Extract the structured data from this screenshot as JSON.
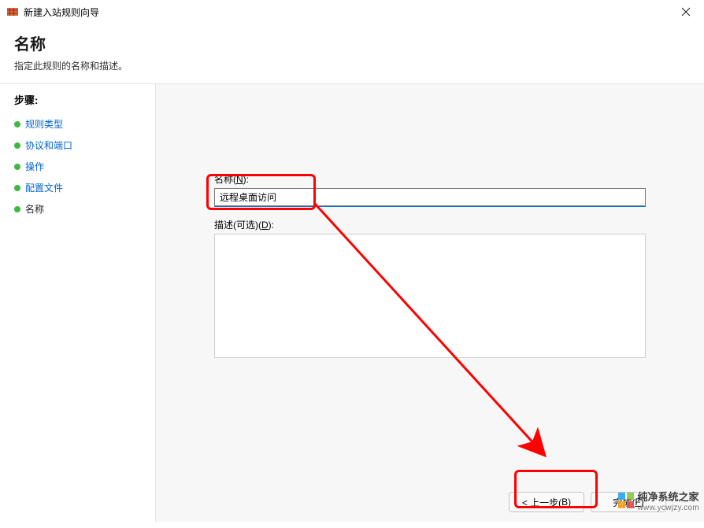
{
  "titlebar": {
    "text": "新建入站规则向导"
  },
  "header": {
    "title": "名称",
    "subtitle": "指定此规则的名称和描述。"
  },
  "sidebar": {
    "steps_label": "步骤:",
    "items": [
      {
        "label": "规则类型",
        "link": true
      },
      {
        "label": "协议和端口",
        "link": true
      },
      {
        "label": "操作",
        "link": true
      },
      {
        "label": "配置文件",
        "link": true
      },
      {
        "label": "名称",
        "link": false
      }
    ]
  },
  "form": {
    "name_label_prefix": "名称(",
    "name_label_hotkey": "N",
    "name_label_suffix": "):",
    "name_value": "远程桌面访问",
    "desc_label_prefix": "描述(可选)(",
    "desc_label_hotkey": "D",
    "desc_label_suffix": "):",
    "desc_value": ""
  },
  "buttons": {
    "back_prefix": "< 上一步(",
    "back_hotkey": "B",
    "back_suffix": ")",
    "finish_prefix": "完成(",
    "finish_hotkey": "F",
    "finish_suffix": ")"
  },
  "watermark": {
    "line1": "纯净系统之家",
    "line2": "www.ycwjzy.com"
  },
  "colors": {
    "accent": "#0078d7",
    "link": "#0066cc",
    "anno": "#ff0000"
  }
}
